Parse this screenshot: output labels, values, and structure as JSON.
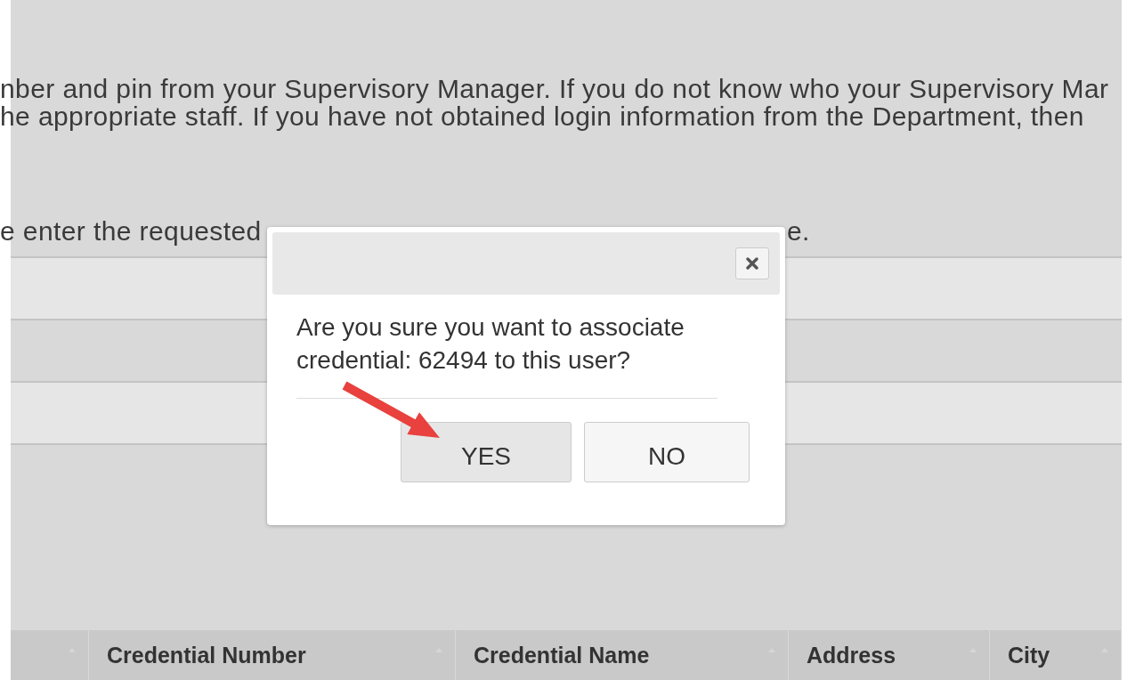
{
  "instructions": {
    "lines": [
      "nber and pin from your Supervisory Manager. If you do not know who your Supervisory Mar",
      "he appropriate staff. If you have not obtained login information from the Department, then"
    ],
    "line_3_start": "e enter the requested",
    "line_3_end": "e."
  },
  "table": {
    "columns": [
      "Credential Number",
      "Credential Name",
      "Address",
      "City"
    ]
  },
  "dialog": {
    "message": "Are you sure you want to associate credential: 62494 to this user?",
    "buttons": [
      {
        "label": "YES",
        "focused": true
      },
      {
        "label": "NO",
        "focused": false
      }
    ]
  }
}
